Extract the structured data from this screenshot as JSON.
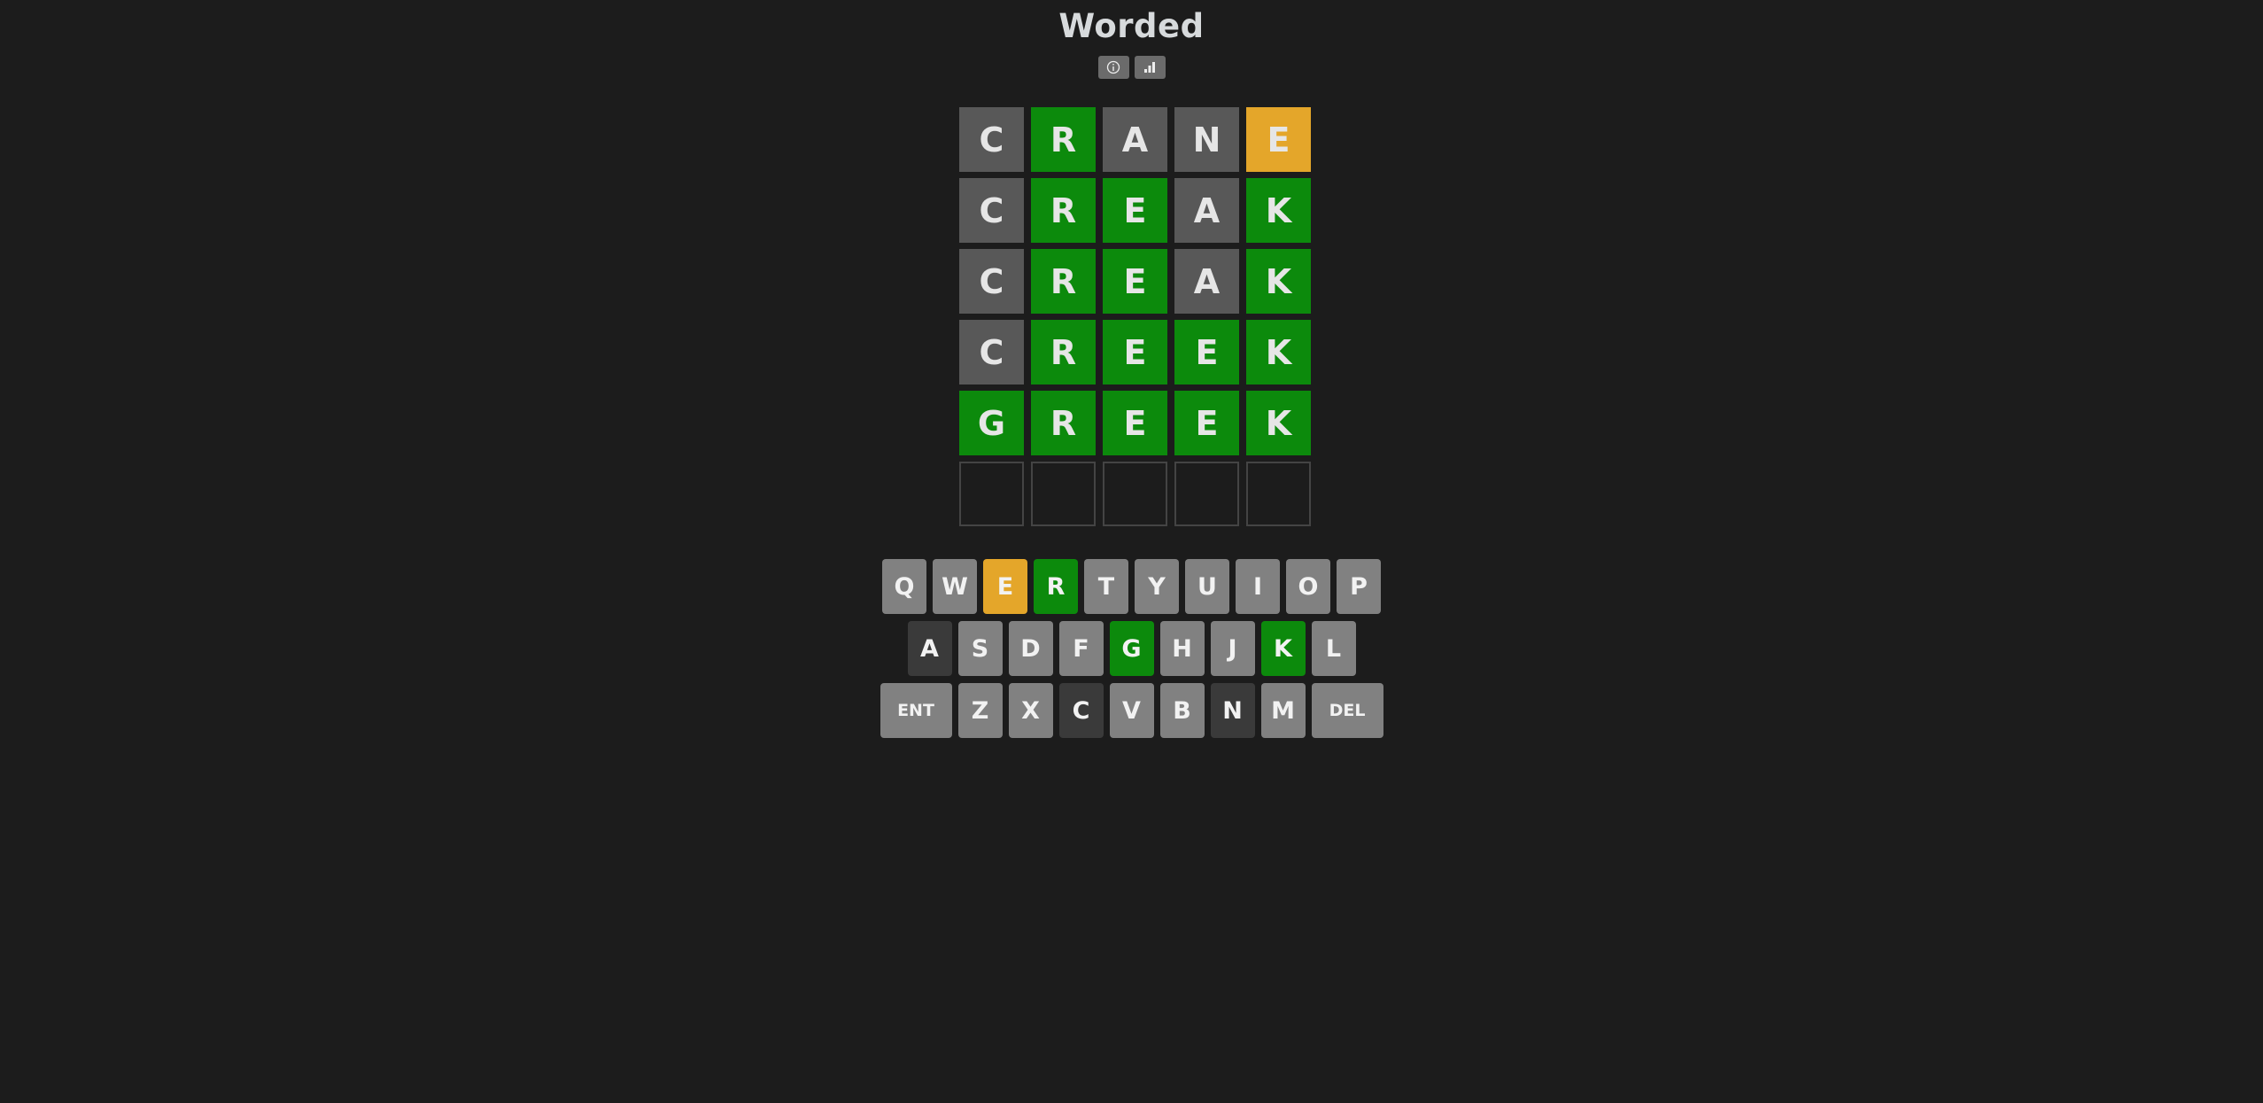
{
  "app": {
    "title": "Worded"
  },
  "header": {
    "icons": [
      {
        "name": "info-icon"
      },
      {
        "name": "stats-icon"
      }
    ]
  },
  "board": {
    "rows": [
      {
        "letters": [
          "C",
          "R",
          "A",
          "N",
          "E"
        ],
        "states": [
          "absent",
          "correct",
          "absent",
          "absent",
          "present"
        ]
      },
      {
        "letters": [
          "C",
          "R",
          "E",
          "A",
          "K"
        ],
        "states": [
          "absent",
          "correct",
          "correct",
          "absent",
          "correct"
        ]
      },
      {
        "letters": [
          "C",
          "R",
          "E",
          "A",
          "K"
        ],
        "states": [
          "absent",
          "correct",
          "correct",
          "absent",
          "correct"
        ]
      },
      {
        "letters": [
          "C",
          "R",
          "E",
          "E",
          "K"
        ],
        "states": [
          "absent",
          "correct",
          "correct",
          "correct",
          "correct"
        ]
      },
      {
        "letters": [
          "G",
          "R",
          "E",
          "E",
          "K"
        ],
        "states": [
          "correct",
          "correct",
          "correct",
          "correct",
          "correct"
        ]
      },
      {
        "letters": [
          "",
          "",
          "",
          "",
          ""
        ],
        "states": [
          "empty",
          "empty",
          "empty",
          "empty",
          "empty"
        ]
      }
    ]
  },
  "keyboard": {
    "rows": [
      [
        {
          "label": "Q",
          "state": "unused"
        },
        {
          "label": "W",
          "state": "unused"
        },
        {
          "label": "E",
          "state": "present"
        },
        {
          "label": "R",
          "state": "correct"
        },
        {
          "label": "T",
          "state": "unused"
        },
        {
          "label": "Y",
          "state": "unused"
        },
        {
          "label": "U",
          "state": "unused"
        },
        {
          "label": "I",
          "state": "unused"
        },
        {
          "label": "O",
          "state": "unused"
        },
        {
          "label": "P",
          "state": "unused"
        }
      ],
      [
        {
          "label": "A",
          "state": "absent"
        },
        {
          "label": "S",
          "state": "unused"
        },
        {
          "label": "D",
          "state": "unused"
        },
        {
          "label": "F",
          "state": "unused"
        },
        {
          "label": "G",
          "state": "correct"
        },
        {
          "label": "H",
          "state": "unused"
        },
        {
          "label": "J",
          "state": "unused"
        },
        {
          "label": "K",
          "state": "correct"
        },
        {
          "label": "L",
          "state": "unused"
        }
      ],
      [
        {
          "label": "ENT",
          "state": "unused",
          "wide": true
        },
        {
          "label": "Z",
          "state": "unused"
        },
        {
          "label": "X",
          "state": "unused"
        },
        {
          "label": "C",
          "state": "absent"
        },
        {
          "label": "V",
          "state": "unused"
        },
        {
          "label": "B",
          "state": "unused"
        },
        {
          "label": "N",
          "state": "absent"
        },
        {
          "label": "M",
          "state": "unused"
        },
        {
          "label": "DEL",
          "state": "unused",
          "wide": true
        }
      ]
    ]
  },
  "colors": {
    "background": "#1c1c1c",
    "correct": "#0c8a0c",
    "present": "#e4a62a",
    "absent": "#585858",
    "key_default": "#818181",
    "key_absent": "#3a3a3a"
  }
}
